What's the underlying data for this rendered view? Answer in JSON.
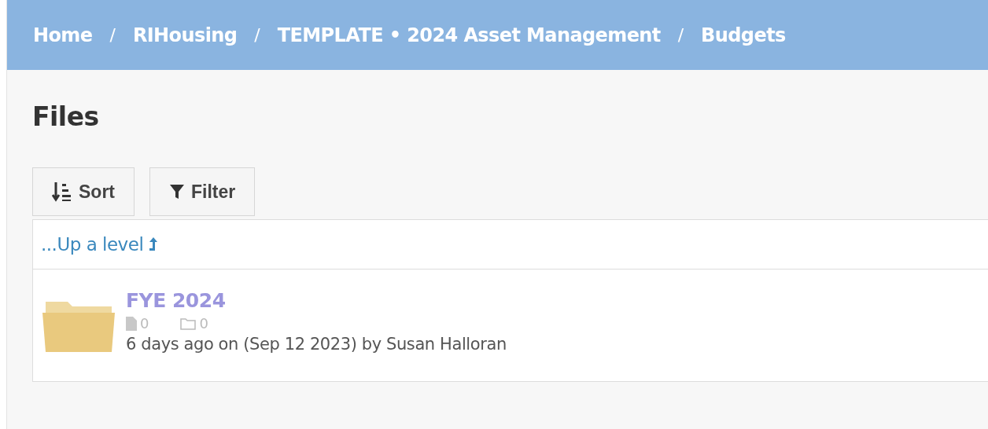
{
  "breadcrumb": [
    {
      "label": "Home"
    },
    {
      "label": "RIHousing"
    },
    {
      "label": "TEMPLATE • 2024 Asset Management"
    },
    {
      "label": "Budgets"
    }
  ],
  "breadcrumb_separator": "/",
  "heading": "Files",
  "toolbar": [
    {
      "kind": "sort",
      "label": "Sort"
    },
    {
      "kind": "filter",
      "label": "Filter"
    }
  ],
  "up_link": "...Up a level",
  "folders": [
    {
      "name": "FYE 2024",
      "files": "0",
      "subfolders": "0",
      "modified": "6 days ago on (Sep 12 2023) by Susan Halloran"
    }
  ]
}
